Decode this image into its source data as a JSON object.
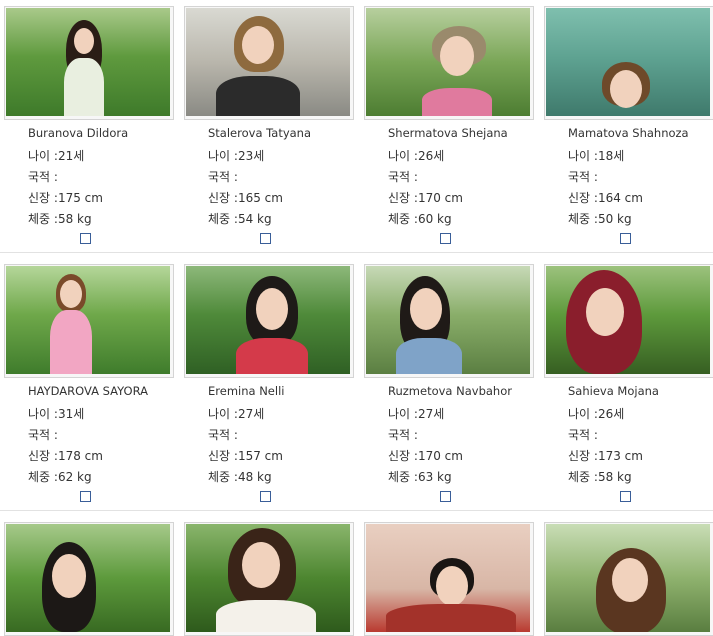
{
  "labels": {
    "age": "나이 :",
    "nationality": "국적 :",
    "height": "신장 :",
    "weight": "체중 :"
  },
  "profiles": [
    {
      "name": "Buranova Dildora",
      "age": "21세",
      "nationality": "",
      "height": "175 cm",
      "weight": "58 kg"
    },
    {
      "name": "Stalerova Tatyana",
      "age": "23세",
      "nationality": "",
      "height": "165 cm",
      "weight": "54 kg"
    },
    {
      "name": "Shermatova Shejana",
      "age": "26세",
      "nationality": "",
      "height": "170 cm",
      "weight": "60 kg"
    },
    {
      "name": "Mamatova Shahnoza",
      "age": "18세",
      "nationality": "",
      "height": "164 cm",
      "weight": "50 kg"
    },
    {
      "name": "HAYDAROVA SAYORA",
      "age": "31세",
      "nationality": "",
      "height": "178 cm",
      "weight": "62 kg"
    },
    {
      "name": "Eremina Nelli",
      "age": "27세",
      "nationality": "",
      "height": "157 cm",
      "weight": "48 kg"
    },
    {
      "name": "Ruzmetova Navbahor",
      "age": "27세",
      "nationality": "",
      "height": "170 cm",
      "weight": "63 kg"
    },
    {
      "name": "Sahieva Mojana",
      "age": "26세",
      "nationality": "",
      "height": "173 cm",
      "weight": "58 kg"
    }
  ],
  "colors": {
    "checkbox_border": "#3a5e98",
    "frame_border": "#d4d4d4",
    "text": "#333333"
  }
}
